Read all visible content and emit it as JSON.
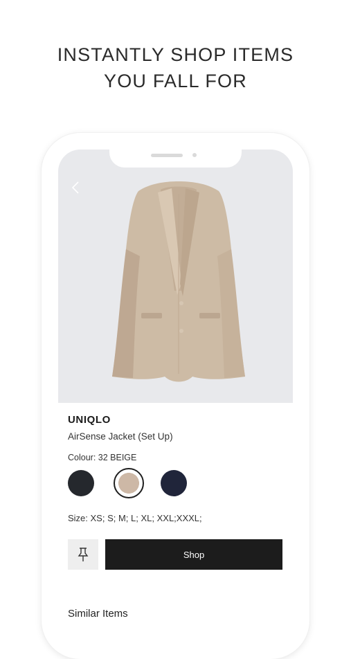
{
  "headline": {
    "line1": "INSTANTLY SHOP ITEMS",
    "line2": "YOU FALL FOR"
  },
  "product": {
    "brand": "UNIQLO",
    "name": "AirSense Jacket (Set Up)",
    "colour_label": "Colour: 32 BEIGE",
    "swatches": [
      {
        "name": "black",
        "color": "#25282d",
        "selected": false
      },
      {
        "name": "beige",
        "color": "#cdb8a6",
        "selected": true
      },
      {
        "name": "navy",
        "color": "#20253a",
        "selected": false
      }
    ],
    "sizes_label": "Size: XS; S; M; L; XL; XXL;XXXL;",
    "shop_label": "Shop",
    "image_icon": "beige-blazer-image"
  },
  "icons": {
    "back": "back-chevron-icon",
    "pin": "pin-icon"
  },
  "similar_title": "Similar Items",
  "colors": {
    "hero_bg": "#e8e9ec",
    "shop_bg": "#1c1c1c",
    "pin_bg": "#eeeeee"
  }
}
